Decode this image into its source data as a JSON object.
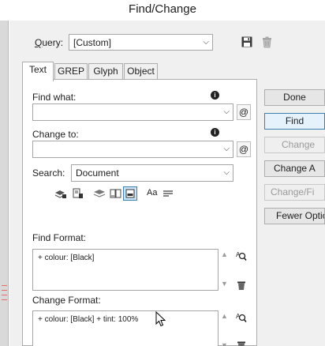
{
  "window": {
    "title": "Find/Change"
  },
  "query": {
    "label": "Query:",
    "value": "[Custom]"
  },
  "tabs": [
    {
      "label": "Text",
      "active": true
    },
    {
      "label": "GREP",
      "active": false
    },
    {
      "label": "Glyph",
      "active": false
    },
    {
      "label": "Object",
      "active": false
    }
  ],
  "find_what": {
    "label": "Find what:",
    "value": ""
  },
  "change_to": {
    "label": "Change to:",
    "value": ""
  },
  "search": {
    "label": "Search:",
    "value": "Document"
  },
  "find_format": {
    "label": "Find Format:",
    "value": "+ colour: [Black]"
  },
  "change_format": {
    "label": "Change Format:",
    "value": "+ colour: [Black] + tint: 100%"
  },
  "buttons": {
    "done": "Done",
    "find": "Find",
    "change": "Change",
    "change_all": "Change A",
    "change_find": "Change/Fi",
    "fewer_options": "Fewer Optio"
  },
  "icons": {
    "options_row": [
      "locked-layers-icon",
      "locked-stories-icon",
      "hidden-layers-icon",
      "master-pages-icon",
      "footnotes-icon",
      "case-sensitive-icon",
      "whole-word-icon"
    ],
    "text_case_glyph": "Aa"
  }
}
